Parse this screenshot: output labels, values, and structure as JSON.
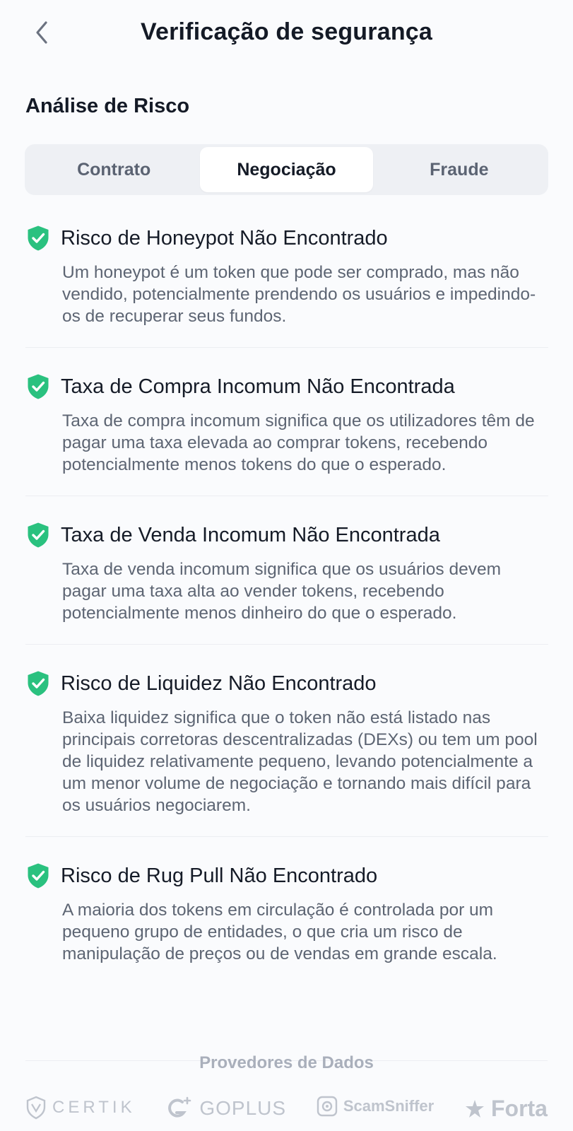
{
  "header": {
    "title": "Verificação de segurança",
    "back_icon": "chevron-left-icon"
  },
  "section": {
    "title": "Análise de Risco"
  },
  "tabs": [
    {
      "label": "Contrato",
      "active": false
    },
    {
      "label": "Negociação",
      "active": true
    },
    {
      "label": "Fraude",
      "active": false
    }
  ],
  "risks": [
    {
      "title": "Risco de Honeypot Não Encontrado",
      "description": "Um honeypot é um token que pode ser comprado, mas não vendido, potencialmente prendendo os usuários e impedindo-os de recuperar seus fundos."
    },
    {
      "title": "Taxa de Compra Incomum Não Encontrada",
      "description": "Taxa de compra incomum significa que os utilizadores têm de pagar uma taxa elevada ao comprar tokens, recebendo potencialmente menos tokens do que o esperado."
    },
    {
      "title": "Taxa de Venda Incomum Não Encontrada",
      "description": "Taxa de venda incomum significa que os usuários devem pagar uma taxa alta ao vender tokens, recebendo potencialmente menos dinheiro do que o esperado."
    },
    {
      "title": "Risco de Liquidez Não Encontrado",
      "description": "Baixa liquidez significa que o token não está listado nas principais corretoras descentralizadas (DEXs) ou tem um pool de liquidez relativamente pequeno, levando potencialmente a um menor volume de negociação e tornando mais difícil para os usuários negociarem."
    },
    {
      "title": "Risco de Rug Pull Não Encontrado",
      "description": "A maioria dos tokens em circulação é controlada por um pequeno grupo de entidades, o que cria um risco de manipulação de preços ou de vendas em grande escala."
    }
  ],
  "providers": {
    "title": "Provedores de Dados",
    "logos": [
      "CERTIK",
      "GOPLUS",
      "ScamSniffer",
      "Forta"
    ]
  },
  "colors": {
    "shield_green": "#2ac17f",
    "muted_logo": "#bfc4cd",
    "accent_text": "#141a26"
  }
}
